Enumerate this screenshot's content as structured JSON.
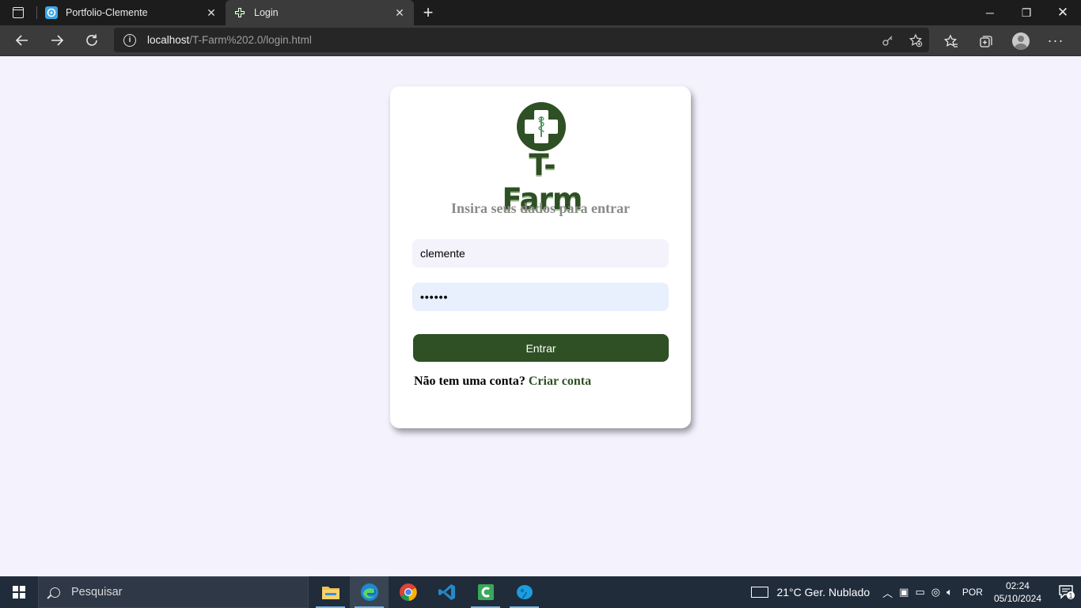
{
  "browser": {
    "tabs": [
      {
        "title": "Portfolio-Clemente",
        "active": false
      },
      {
        "title": "Login",
        "active": true
      }
    ],
    "url_host": "localhost",
    "url_path": "/T-Farm%202.0/login.html"
  },
  "login": {
    "brand": "T-Farm",
    "heading": "Insira seus dados para entrar",
    "username_value": "clemente",
    "password_value": "••••••",
    "submit_label": "Entrar",
    "signup_prompt": "Não tem uma conta?",
    "signup_link": "Criar conta"
  },
  "taskbar": {
    "search_placeholder": "Pesquisar",
    "weather": "21°C  Ger. Nublado",
    "language": "POR",
    "time": "02:24",
    "date": "05/10/2024",
    "notification_count": "1"
  },
  "colors": {
    "brand_green": "#2e5024",
    "page_bg": "#f3f2fd"
  }
}
